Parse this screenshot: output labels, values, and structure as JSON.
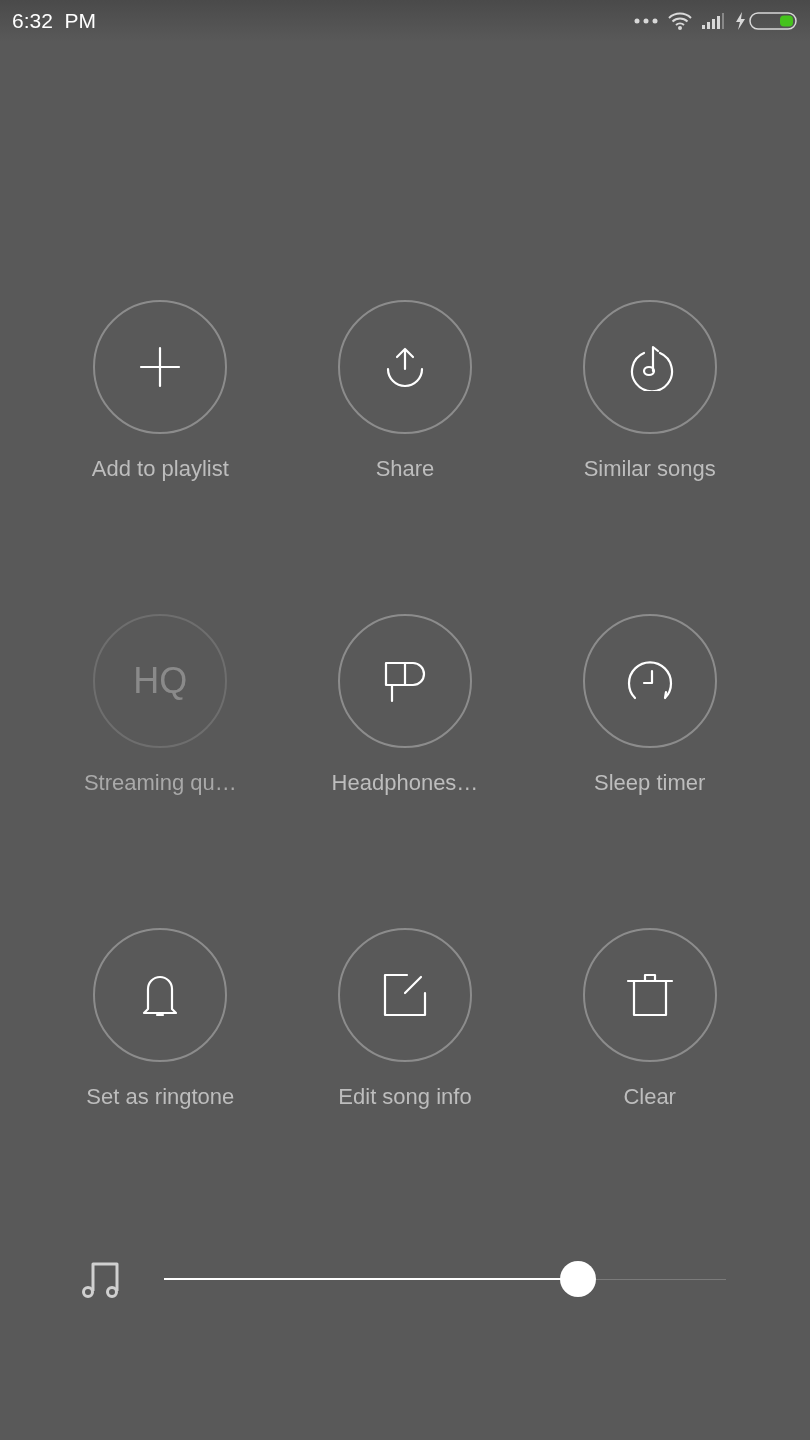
{
  "status_bar": {
    "time": "6:32  PM"
  },
  "actions": [
    {
      "kind": "plus",
      "label": "Add to playlist",
      "disabled": false
    },
    {
      "kind": "share",
      "label": "Share",
      "disabled": false
    },
    {
      "kind": "similar",
      "label": "Similar songs",
      "disabled": false
    },
    {
      "kind": "text",
      "text": "HQ",
      "label": "Streaming qu…",
      "disabled": true
    },
    {
      "kind": "earphone",
      "label": "Headphones…",
      "disabled": false
    },
    {
      "kind": "timer",
      "label": "Sleep timer",
      "disabled": false
    },
    {
      "kind": "bell",
      "label": "Set as ringtone",
      "disabled": false
    },
    {
      "kind": "edit",
      "label": "Edit song info",
      "disabled": false
    },
    {
      "kind": "trash",
      "label": "Clear",
      "disabled": false
    }
  ],
  "volume": {
    "level": 0.737
  }
}
